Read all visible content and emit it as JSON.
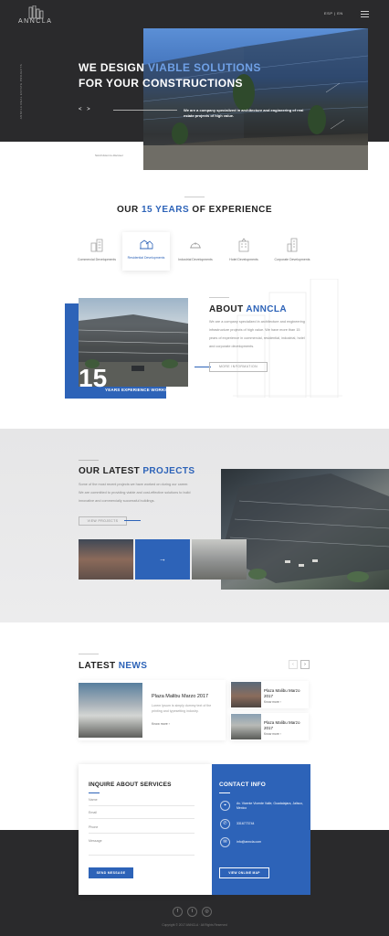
{
  "header": {
    "logo_text": "ANNCLA",
    "lang": "ESP | EN",
    "vertical_tag": "ANNCLA REAL ESTATE PROJECTS"
  },
  "hero": {
    "title_line1_a": "WE DESIGN ",
    "title_line1_b": "VIABLE SOLUTIONS",
    "title_line2": "FOR YOUR CONSTRUCTIONS",
    "description": "We are a company specialized in architecture and engineering of real estate projects of high value.",
    "arrows": "< >",
    "scroll_label": "Scroll down to discover"
  },
  "experience": {
    "title_a": "OUR ",
    "title_b": "15 YEARS",
    "title_c": " OF EXPERIENCE",
    "categories": [
      {
        "label": "Commercial Developments",
        "icon": "office-buildings-icon"
      },
      {
        "label": "Residential Developments",
        "icon": "residential-icon"
      },
      {
        "label": "Industrial Developments",
        "icon": "industrial-helmet-icon"
      },
      {
        "label": "Hotel Developments",
        "icon": "hotel-icon"
      },
      {
        "label": "Corporate Developments",
        "icon": "corporate-tower-icon"
      }
    ]
  },
  "about": {
    "title_a": "ABOUT ",
    "title_b": "ANNCLA",
    "text": "We are a company specialized in architecture and engineering infrastructure projects of high value. We have more than 15 years of experience in commercial, residential, industrial, hotel and corporate developments.",
    "button": "MORE INFORMATION",
    "years_number": "15",
    "years_label": "YEARS EXPERIENCE WORKING"
  },
  "projects": {
    "title_a": "OUR LATEST ",
    "title_b": "PROJECTS",
    "text": "Some of the most recent projects we have worked on during our career. We are committed to providing viable and cost-effective solutions to build innovative and commercially successful buildings.",
    "button": "VIEW PROJECTS",
    "arrow": "→"
  },
  "news": {
    "title_a": "LATEST ",
    "title_b": "NEWS",
    "prev": "‹",
    "next": "›",
    "main": {
      "title": "Plaza Malibu Marzo 2017",
      "text": "Lorem Ipsum is simply dummy text of the printing and typesetting industry.",
      "more": "Know more  ›"
    },
    "side": [
      {
        "title": "Plaza Malibu Marzo 2017",
        "more": "Know more  ›"
      },
      {
        "title": "Plaza Malibu Marzo 2017",
        "more": "Know more  ›"
      }
    ]
  },
  "inquire": {
    "title": "INQUIRE ABOUT SERVICES",
    "fields": {
      "name": "Name",
      "email": "Email",
      "phone": "Phone",
      "message": "Message"
    },
    "button": "SEND MESSAGE"
  },
  "contact": {
    "title": "CONTACT INFO",
    "address": "Av. Vicente Vicente Valle, Guadalajara, Jalisco, Mexico",
    "phone": "3316773744",
    "email": "info@anncla.com",
    "map_button": "VIEW ONLINE MAP"
  },
  "footer": {
    "social": [
      "f",
      "t",
      "◎"
    ],
    "copyright": "Copyright © 2017 ANNCLA · All Rights Reserved"
  },
  "colors": {
    "accent": "#2d63b8",
    "dark": "#2a2a2c"
  }
}
